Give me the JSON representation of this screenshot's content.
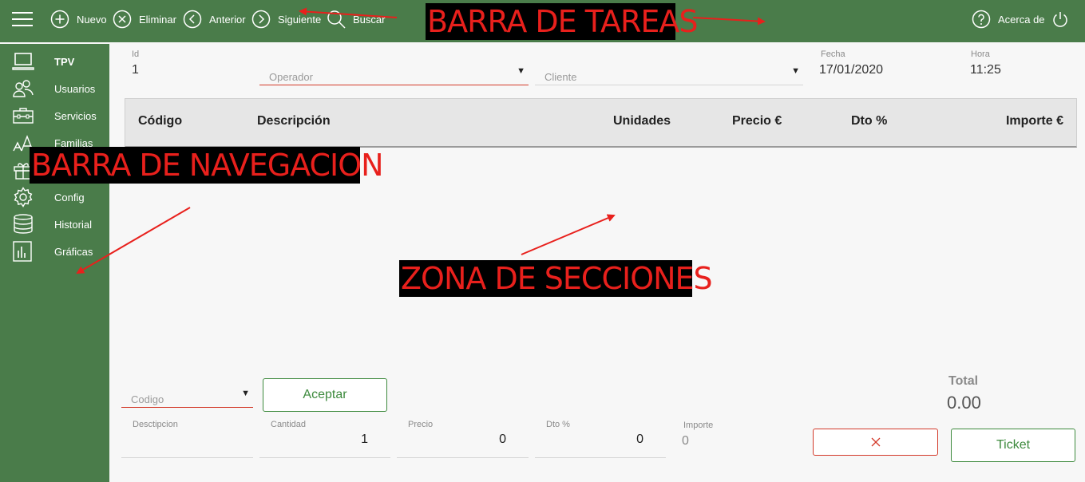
{
  "toolbar": {
    "new_label": "Nuevo",
    "delete_label": "Eliminar",
    "prev_label": "Anterior",
    "next_label": "Siguiente",
    "search_label": "Buscar",
    "about_label": "Acerca de"
  },
  "sidebar": {
    "items": [
      {
        "label": "TPV",
        "icon": "laptop-icon",
        "active": true
      },
      {
        "label": "Usuarios",
        "icon": "users-icon"
      },
      {
        "label": "Servicios",
        "icon": "briefcase-icon"
      },
      {
        "label": "Familias",
        "icon": "font-size-icon"
      },
      {
        "label": "",
        "icon": "gift-icon"
      },
      {
        "label": "Config",
        "icon": "gear-icon"
      },
      {
        "label": "Historial",
        "icon": "database-icon"
      },
      {
        "label": "Gráficas",
        "icon": "bar-chart-icon"
      }
    ]
  },
  "header_form": {
    "id_label": "Id",
    "id_value": "1",
    "operator_placeholder": "Operador",
    "client_placeholder": "Cliente",
    "date_label": "Fecha",
    "date_value": "17/01/2020",
    "time_label": "Hora",
    "time_value": "11:25"
  },
  "table": {
    "columns": [
      "Código",
      "Descripción",
      "Unidades",
      "Precio €",
      "Dto %",
      "Importe €"
    ],
    "rows": []
  },
  "entry": {
    "code_placeholder": "Codigo",
    "accept_label": "Aceptar",
    "description_label": "Desctipcion",
    "description_value": "",
    "quantity_label": "Cantidad",
    "quantity_value": "1",
    "price_label": "Precio",
    "price_value": "0",
    "discount_label": "Dto %",
    "discount_value": "0",
    "amount_label": "Importe",
    "amount_value": "0"
  },
  "totals": {
    "total_label": "Total",
    "total_value": "0.00",
    "cancel_icon": "close-icon",
    "ticket_label": "Ticket"
  },
  "annotations": {
    "taskbar": "BARRA DE TAREAS",
    "navbar": "BARRA DE NAVEGACION",
    "sections": "ZONA DE SECCIONES"
  },
  "colors": {
    "brand_green": "#4a7c4a",
    "accent_green": "#3d8a3d",
    "error_red": "#d33a2a",
    "annotation_red": "#e8201c"
  }
}
